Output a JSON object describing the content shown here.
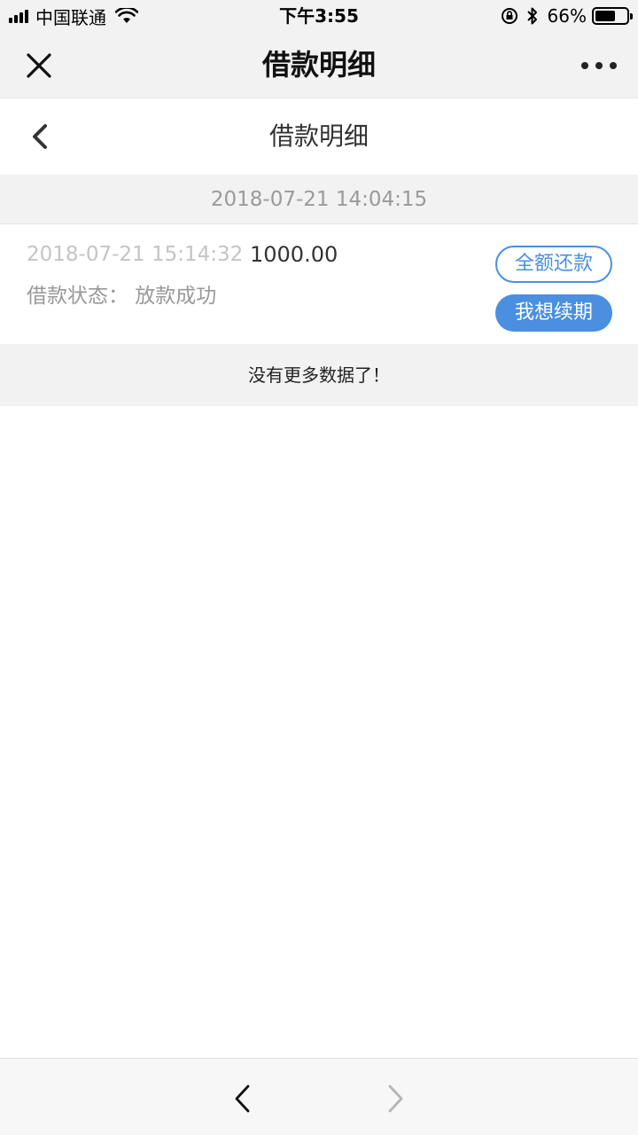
{
  "status_bar": {
    "carrier": "中国联通",
    "time": "下午3:55",
    "battery": "66%",
    "battery_level": 0.66
  },
  "wechat_nav": {
    "title": "借款明细"
  },
  "page_header": {
    "title": "借款明细"
  },
  "group": {
    "date": "2018-07-21 14:04:15"
  },
  "record": {
    "time": "2018-07-21 15:14:32",
    "amount": "1000.00",
    "status": "借款状态：  放款成功",
    "repay_label": "全额还款",
    "renew_label": "我想续期"
  },
  "list_footer": {
    "no_more": "没有更多数据了！"
  },
  "colors": {
    "accent": "#4a8fe0",
    "bar_bg": "#f2f2f2"
  }
}
